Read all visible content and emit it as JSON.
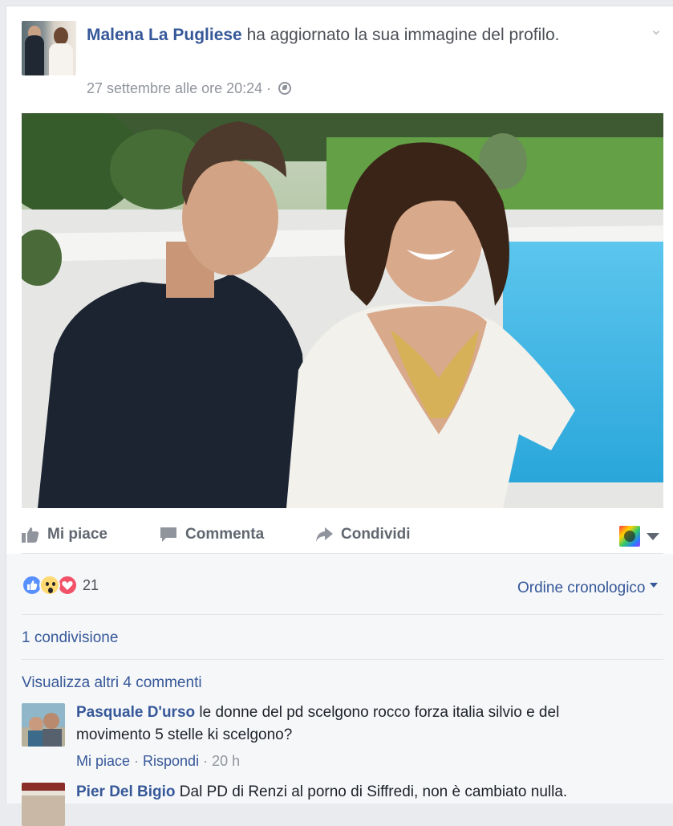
{
  "post": {
    "author": "Malena La Pugliese",
    "action_text": " ha aggiornato la sua immagine del profilo.",
    "timestamp": "27 settembre alle ore 20:24",
    "separator": " · ",
    "privacy_icon": "globe-icon"
  },
  "actions": {
    "like": "Mi piace",
    "comment": "Commenta",
    "share": "Condividi"
  },
  "reactions": {
    "icons": [
      "like",
      "wow",
      "love"
    ],
    "count": "21"
  },
  "sort": {
    "label": "Ordine cronologico"
  },
  "shares": "1 condivisione",
  "more_comments": "Visualizza altri 4 commenti",
  "comments": [
    {
      "author": "Pasquale D'urso",
      "text": " le donne del pd scelgono rocco forza italia silvio e del movimento 5 stelle ki scelgono?",
      "like": "Mi piace",
      "reply": "Rispondi",
      "time": "20 h"
    },
    {
      "author": "Pier Del Bigio",
      "text": " Dal PD di Renzi al porno di Siffredi, non è cambiato nulla."
    }
  ],
  "colors": {
    "link": "#365899",
    "muted": "#90949c",
    "background": "#f6f7f9",
    "pool": "#3fb3e3"
  }
}
